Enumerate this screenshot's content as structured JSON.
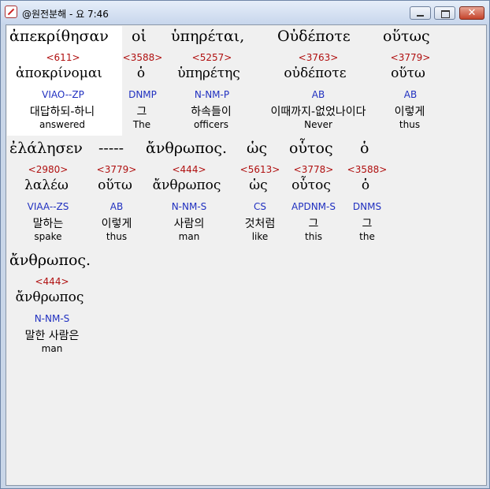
{
  "window": {
    "title": "@원전분해 - 요 7:46"
  },
  "rows": [
    {
      "words": [
        {
          "greek": "ἀπεκρίθησαν",
          "strong": "<611>",
          "lemma": "ἀποκρίνομαι",
          "parse": "VIAO--ZP",
          "korean": "대답하되-하니",
          "english": "answered"
        },
        {
          "greek": "οἱ",
          "strong": "<3588>",
          "lemma": "ὁ",
          "parse": "DNMP",
          "korean": "그",
          "english": "The"
        },
        {
          "greek": "ὑπηρέται,",
          "strong": "<5257>",
          "lemma": "ὑπηρέτης",
          "parse": "N-NM-P",
          "korean": "하속들이",
          "english": "officers"
        },
        {
          "greek": "Οὐδέποτε",
          "strong": "<3763>",
          "lemma": "οὐδέποτε",
          "parse": "AB",
          "korean": "이때까지-없었나이다",
          "english": "Never"
        },
        {
          "greek": "οὕτως",
          "strong": "<3779>",
          "lemma": "οὕτω",
          "parse": "AB",
          "korean": "이렇게",
          "english": "thus"
        }
      ]
    },
    {
      "words": [
        {
          "greek": "ἐλάλησεν",
          "strong": "<2980>",
          "lemma": "λαλέω",
          "parse": "VIAA--ZS",
          "korean": "말하는",
          "english": "spake"
        },
        {
          "greek": "-----",
          "strong": "<3779>",
          "lemma": "οὕτω",
          "parse": "AB",
          "korean": "이렇게",
          "english": "thus"
        },
        {
          "greek": "ἄνθρωπος.",
          "strong": "<444>",
          "lemma": "ἄνθρωπος",
          "parse": "N-NM-S",
          "korean": "사람의",
          "english": "man"
        },
        {
          "greek": "ὡς",
          "strong": "<5613>",
          "lemma": "ὡς",
          "parse": "CS",
          "korean": "것처럼",
          "english": "like"
        },
        {
          "greek": "οὗτος",
          "strong": "<3778>",
          "lemma": "οὗτος",
          "parse": "APDNM-S",
          "korean": "그",
          "english": "this"
        },
        {
          "greek": "ὁ",
          "strong": "<3588>",
          "lemma": "ὁ",
          "parse": "DNMS",
          "korean": "그",
          "english": "the"
        }
      ]
    },
    {
      "words": [
        {
          "greek": "ἄνθρωπος.",
          "strong": "<444>",
          "lemma": "ἄνθρωπος",
          "parse": "N-NM-S",
          "korean": "말한 사람은",
          "english": "man"
        }
      ]
    }
  ]
}
